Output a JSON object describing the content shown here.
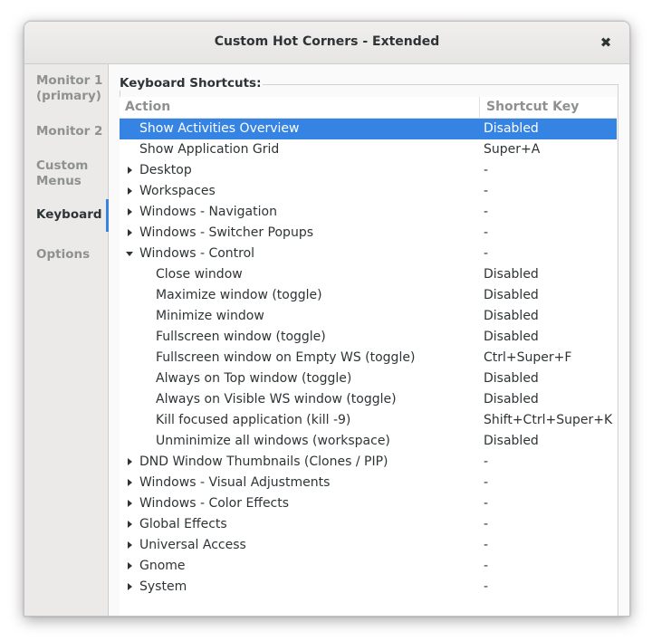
{
  "window": {
    "title": "Custom Hot Corners - Extended",
    "close_glyph": "✖"
  },
  "sidebar": {
    "items": [
      {
        "label": "Monitor 1\n(primary)",
        "active": false
      },
      {
        "label": "Monitor 2",
        "active": false
      },
      {
        "label": "Custom\nMenus",
        "active": false
      },
      {
        "label": "Keyboard",
        "active": true
      },
      {
        "label": "Options",
        "active": false
      }
    ]
  },
  "content": {
    "section_title": "Keyboard Shortcuts:",
    "columns": {
      "action": "Action",
      "shortcut": "Shortcut Key"
    },
    "rows": [
      {
        "action": "Show Activities Overview",
        "key": "Disabled",
        "expander": "none",
        "selected": true,
        "level": 0
      },
      {
        "action": "Show Application Grid",
        "key": "Super+A",
        "expander": "none",
        "level": 0
      },
      {
        "action": "Desktop",
        "key": "-",
        "expander": "collapsed",
        "level": 0
      },
      {
        "action": "Workspaces",
        "key": "-",
        "expander": "collapsed",
        "level": 0
      },
      {
        "action": "Windows - Navigation",
        "key": "-",
        "expander": "collapsed",
        "level": 0
      },
      {
        "action": "Windows - Switcher Popups",
        "key": "-",
        "expander": "collapsed",
        "level": 0
      },
      {
        "action": "Windows - Control",
        "key": "-",
        "expander": "expanded",
        "level": 0
      },
      {
        "action": "Close window",
        "key": "Disabled",
        "expander": "none",
        "level": 1
      },
      {
        "action": "Maximize window (toggle)",
        "key": "Disabled",
        "expander": "none",
        "level": 1
      },
      {
        "action": "Minimize window",
        "key": "Disabled",
        "expander": "none",
        "level": 1
      },
      {
        "action": "Fullscreen window (toggle)",
        "key": "Disabled",
        "expander": "none",
        "level": 1
      },
      {
        "action": "Fullscreen window on Empty WS (toggle)",
        "key": "Ctrl+Super+F",
        "expander": "none",
        "level": 1
      },
      {
        "action": "Always on Top window (toggle)",
        "key": "Disabled",
        "expander": "none",
        "level": 1
      },
      {
        "action": "Always on Visible WS window (toggle)",
        "key": "Disabled",
        "expander": "none",
        "level": 1
      },
      {
        "action": "Kill focused application (kill -9)",
        "key": "Shift+Ctrl+Super+K",
        "expander": "none",
        "level": 1
      },
      {
        "action": "Unminimize all windows (workspace)",
        "key": "Disabled",
        "expander": "none",
        "level": 1
      },
      {
        "action": "DND Window Thumbnails (Clones / PIP)",
        "key": "-",
        "expander": "collapsed",
        "level": 0
      },
      {
        "action": "Windows - Visual Adjustments",
        "key": "-",
        "expander": "collapsed",
        "level": 0
      },
      {
        "action": "Windows - Color Effects",
        "key": "-",
        "expander": "collapsed",
        "level": 0
      },
      {
        "action": "Global Effects",
        "key": "-",
        "expander": "collapsed",
        "level": 0
      },
      {
        "action": "Universal Access",
        "key": "-",
        "expander": "collapsed",
        "level": 0
      },
      {
        "action": "Gnome",
        "key": "-",
        "expander": "collapsed",
        "level": 0
      },
      {
        "action": "System",
        "key": "-",
        "expander": "collapsed",
        "level": 0
      }
    ]
  },
  "colors": {
    "accent": "#3584e4",
    "text": "#2e3436",
    "dim_text": "#8e9091",
    "sidebar_bg": "#ebeae9"
  }
}
